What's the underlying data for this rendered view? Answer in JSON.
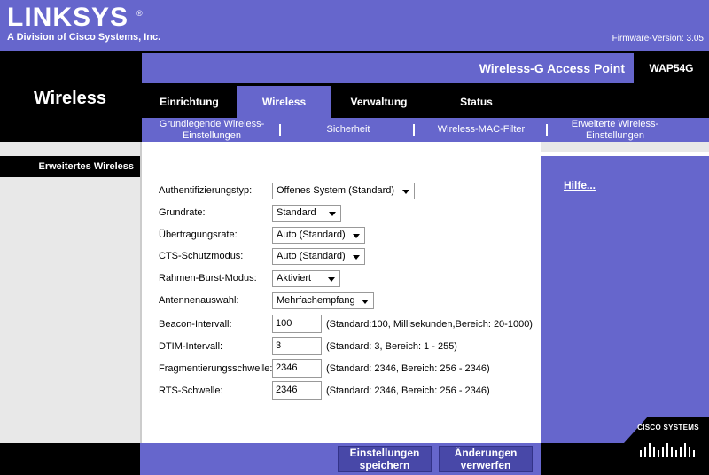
{
  "brand": {
    "name": "LINKSYS",
    "tagline": "A Division of Cisco Systems, Inc.",
    "registered": "®"
  },
  "firmware": "Firmware-Version: 3.05",
  "section_title": "Wireless",
  "product": {
    "name": "Wireless-G Access Point",
    "model": "WAP54G"
  },
  "tabs": [
    {
      "label": "Einrichtung",
      "active": false
    },
    {
      "label": "Wireless",
      "active": true
    },
    {
      "label": "Verwaltung",
      "active": false
    },
    {
      "label": "Status",
      "active": false
    }
  ],
  "subnav": [
    {
      "label": "Grundlegende Wireless-Einstellungen"
    },
    {
      "label": "Sicherheit"
    },
    {
      "label": "Wireless-MAC-Filter"
    },
    {
      "label": "Erweiterte Wireless-Einstellungen"
    }
  ],
  "left_label": "Erweitertes Wireless",
  "form": {
    "auth_type": {
      "label": "Authentifizierungstyp:",
      "value": "Offenes System (Standard)"
    },
    "basic_rate": {
      "label": "Grundrate:",
      "value": "Standard"
    },
    "tx_rate": {
      "label": "Übertragungsrate:",
      "value": "Auto (Standard)"
    },
    "cts_mode": {
      "label": "CTS-Schutzmodus:",
      "value": "Auto (Standard)"
    },
    "frame_burst": {
      "label": "Rahmen-Burst-Modus:",
      "value": "Aktiviert"
    },
    "antenna": {
      "label": "Antennenauswahl:",
      "value": "Mehrfachempfang"
    },
    "beacon": {
      "label": "Beacon-Intervall:",
      "value": "100",
      "hint": "(Standard:100, Millisekunden,Bereich: 20-1000)"
    },
    "dtim": {
      "label": "DTIM-Intervall:",
      "value": "3",
      "hint": "(Standard: 3, Bereich: 1 - 255)"
    },
    "frag": {
      "label": "Fragmentierungsschwelle:",
      "value": "2346",
      "hint": "(Standard: 2346, Bereich: 256 - 2346)"
    },
    "rts": {
      "label": "RTS-Schwelle:",
      "value": "2346",
      "hint": "(Standard: 2346, Bereich: 256 - 2346)"
    }
  },
  "help_link": "Hilfe...",
  "buttons": {
    "save": "Einstellungen speichern",
    "discard": "Änderungen verwerfen"
  },
  "cisco_logo_text": "CISCO SYSTEMS",
  "colors": {
    "accent": "#6666cc",
    "dark": "#000000",
    "button": "#4848a8"
  }
}
